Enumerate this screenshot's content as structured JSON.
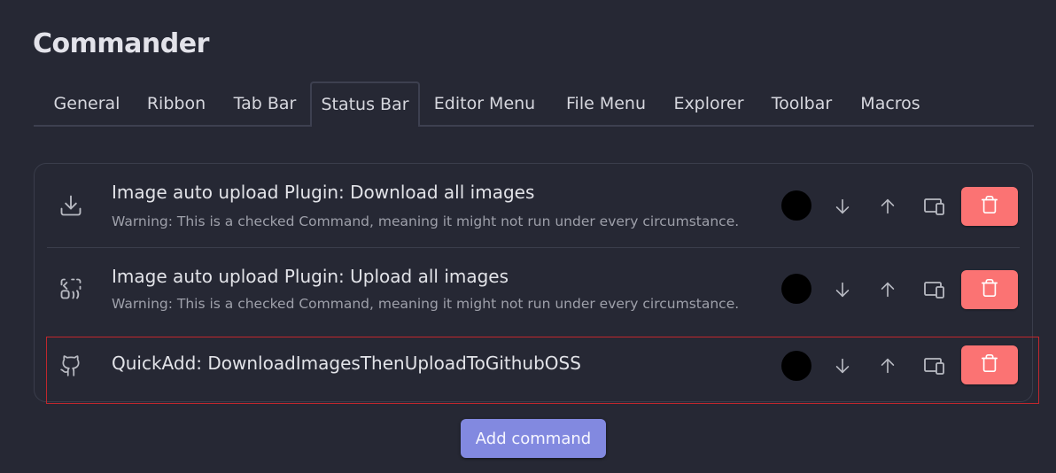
{
  "page": {
    "title": "Commander"
  },
  "tabs": [
    {
      "label": "General"
    },
    {
      "label": "Ribbon"
    },
    {
      "label": "Tab Bar"
    },
    {
      "label": "Status Bar",
      "active": true
    },
    {
      "label": "Editor Menu"
    },
    {
      "label": "File Menu"
    },
    {
      "label": "Explorer"
    },
    {
      "label": "Toolbar"
    },
    {
      "label": "Macros"
    }
  ],
  "commands": [
    {
      "icon": "download-icon",
      "title": "Image auto upload Plugin: Download all images",
      "warning": "Warning: This is a checked Command, meaning it might not run under every circumstance.",
      "color": "#000000"
    },
    {
      "icon": "scan-face-icon",
      "title": "Image auto upload Plugin: Upload all images",
      "warning": "Warning: This is a checked Command, meaning it might not run under every circumstance.",
      "color": "#000000"
    },
    {
      "icon": "github-icon",
      "title": "QuickAdd: DownloadImagesThenUploadToGithubOSS",
      "warning": "",
      "color": "#000000"
    }
  ],
  "actions": {
    "add_command": "Add command"
  },
  "colors": {
    "accent": "#8289e0",
    "danger": "#fb7373",
    "highlight": "#c0272d"
  }
}
